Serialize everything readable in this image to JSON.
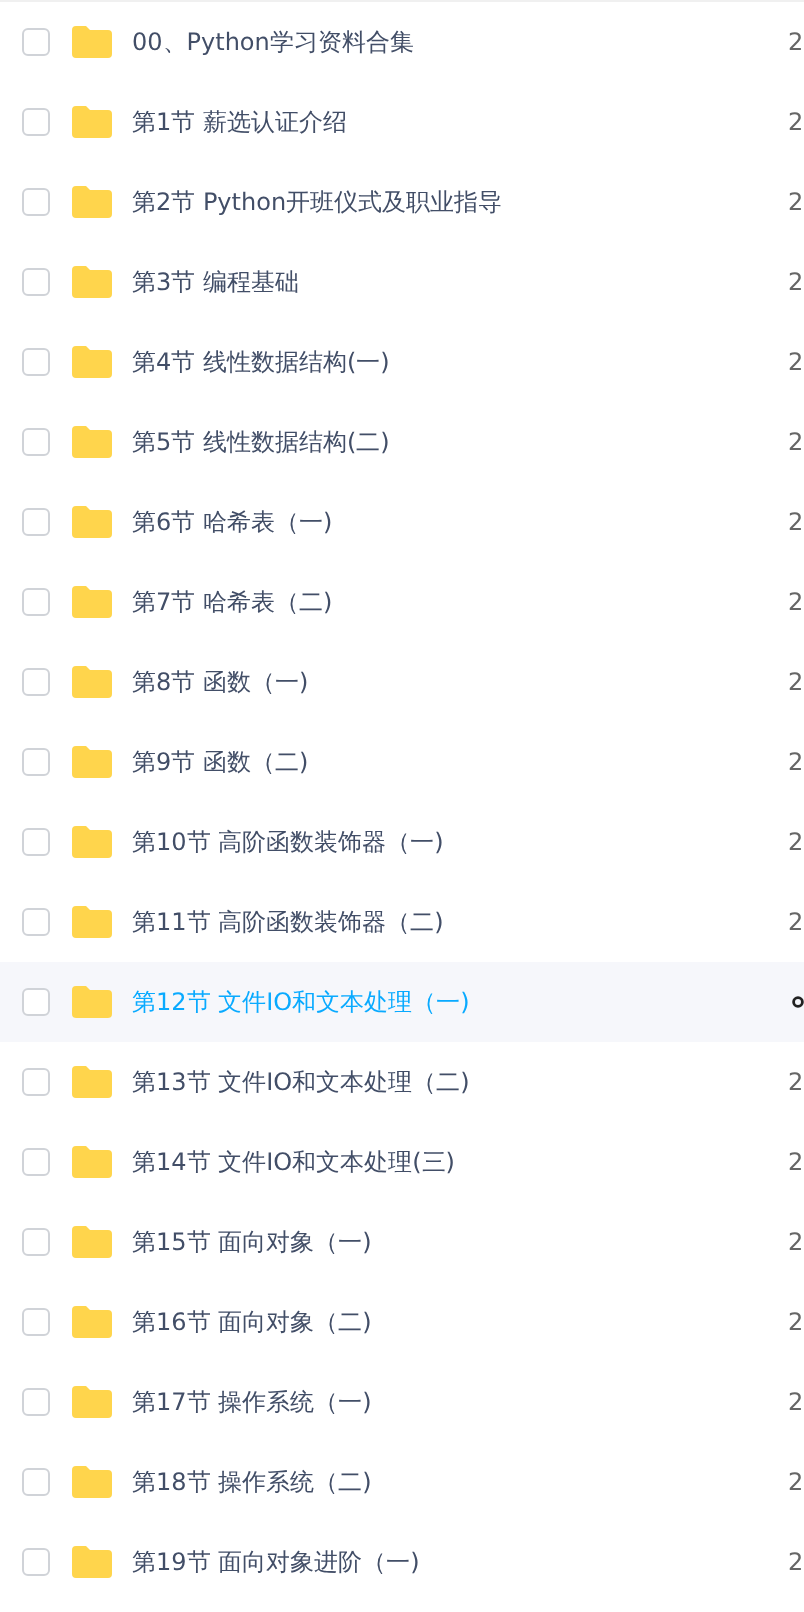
{
  "files": [
    {
      "name": "00、Python学习资料合集",
      "column_2": "2",
      "selected": false
    },
    {
      "name": "第1节 薪选认证介绍",
      "column_2": "2",
      "selected": false
    },
    {
      "name": "第2节 Python开班仪式及职业指导",
      "column_2": "2",
      "selected": false
    },
    {
      "name": "第3节 编程基础",
      "column_2": "2",
      "selected": false
    },
    {
      "name": "第4节 线性数据结构(一)",
      "column_2": "2",
      "selected": false
    },
    {
      "name": "第5节 线性数据结构(二)",
      "column_2": "2",
      "selected": false
    },
    {
      "name": "第6节 哈希表（一)",
      "column_2": "2",
      "selected": false
    },
    {
      "name": "第7节 哈希表（二)",
      "column_2": "2",
      "selected": false
    },
    {
      "name": "第8节 函数（一)",
      "column_2": "2",
      "selected": false
    },
    {
      "name": "第9节 函数（二)",
      "column_2": "2",
      "selected": false
    },
    {
      "name": "第10节 高阶函数装饰器（一)",
      "column_2": "2",
      "selected": false
    },
    {
      "name": "第11节 高阶函数装饰器（二)",
      "column_2": "2",
      "selected": false
    },
    {
      "name": "第12节 文件IO和文本处理（一)",
      "selected": true
    },
    {
      "name": "第13节 文件IO和文本处理（二)",
      "column_2": "2",
      "selected": false
    },
    {
      "name": "第14节 文件IO和文本处理(三)",
      "column_2": "2",
      "selected": false
    },
    {
      "name": "第15节 面向对象（一)",
      "column_2": "2",
      "selected": false
    },
    {
      "name": "第16节 面向对象（二)",
      "column_2": "2",
      "selected": false
    },
    {
      "name": "第17节 操作系统（一)",
      "column_2": "2",
      "selected": false
    },
    {
      "name": "第18节 操作系统（二)",
      "column_2": "2",
      "selected": false
    },
    {
      "name": "第19节 面向对象进阶（一)",
      "column_2": "2",
      "selected": false
    }
  ]
}
